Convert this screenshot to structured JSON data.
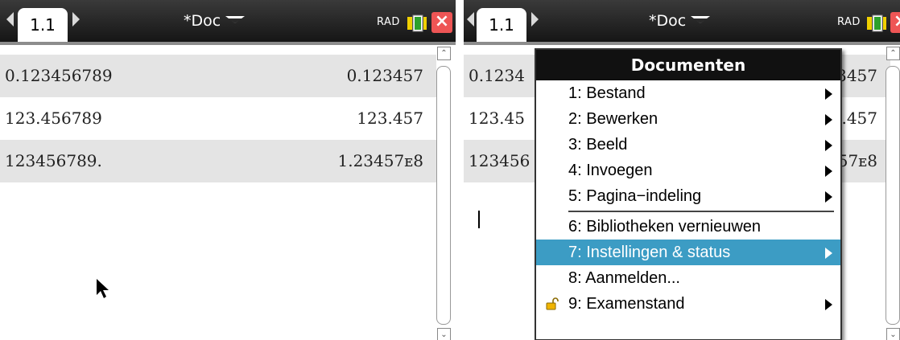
{
  "colors": {
    "menu_selected": "#3c9cc4",
    "close_button": "#e55555",
    "row_shade": "#e4e4e4",
    "topbar": "#1e1e1e"
  },
  "left": {
    "tab_label": "1.1",
    "doc_title": "*Doc",
    "angle_mode": "RAD",
    "rows": [
      {
        "input": "0.123456789",
        "output": "0.123457"
      },
      {
        "input": "123.456789",
        "output": "123.457"
      },
      {
        "input": "123456789.",
        "output": "1.23457ᴇ8"
      }
    ]
  },
  "right": {
    "tab_label": "1.1",
    "doc_title": "*Doc",
    "angle_mode": "RAD",
    "rows": [
      {
        "input": "0.1234",
        "output": "3457"
      },
      {
        "input": "123.45",
        "output": ".457"
      },
      {
        "input": "123456",
        "output": "57ᴇ8"
      }
    ],
    "menu": {
      "title": "Documenten",
      "items": [
        {
          "label": "1: Bestand",
          "submenu": true
        },
        {
          "label": "2: Bewerken",
          "submenu": true
        },
        {
          "label": "3: Beeld",
          "submenu": true
        },
        {
          "label": "4: Invoegen",
          "submenu": true
        },
        {
          "label": "5: Pagina−indeling",
          "submenu": true
        },
        {
          "label": "6: Bibliotheken vernieuwen",
          "submenu": false
        },
        {
          "label": "7: Instellingen & status",
          "submenu": true,
          "selected": true
        },
        {
          "label": "8: Aanmelden...",
          "submenu": false
        },
        {
          "label": "9: Examenstand",
          "submenu": true,
          "icon": "unlocked-padlock-icon"
        }
      ]
    }
  }
}
